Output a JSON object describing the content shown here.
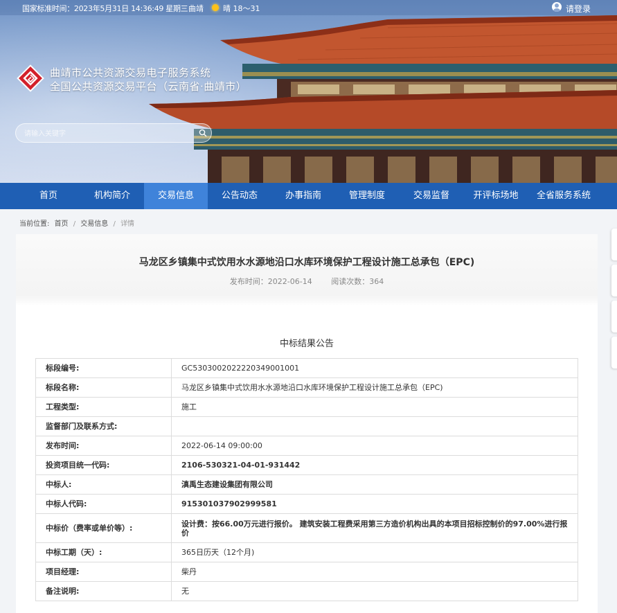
{
  "topbar": {
    "time_text": "国家标准时间：2023年5月31日 14:36:49 星期三",
    "city": "曲靖",
    "weather": "晴 18～31",
    "login": "请登录"
  },
  "site": {
    "title_line1": "曲靖市公共资源交易电子服务系统",
    "title_line2": "全国公共资源交易平台（云南省·曲靖市）"
  },
  "search": {
    "placeholder": "请输入关键字"
  },
  "nav": {
    "items": [
      "首页",
      "机构简介",
      "交易信息",
      "公告动态",
      "办事指南",
      "管理制度",
      "交易监督",
      "开评标场地",
      "全省服务系统"
    ],
    "active_index": 2
  },
  "breadcrumb": {
    "label": "当前位置:",
    "items": [
      "首页",
      "交易信息",
      "详情"
    ]
  },
  "article": {
    "title": "马龙区乡镇集中式饮用水水源地沿口水库环境保护工程设计施工总承包（EPC)",
    "publish": "发布时间：2022-06-14",
    "views": "阅读次数：364"
  },
  "notice": {
    "title": "中标结果公告",
    "rows": [
      {
        "key": "标段编号:",
        "value": "GC5303002022220349001001"
      },
      {
        "key": "标段名称:",
        "value": "马龙区乡镇集中式饮用水水源地沿口水库环境保护工程设计施工总承包（EPC)"
      },
      {
        "key": "工程类型:",
        "value": "施工"
      },
      {
        "key": "监督部门及联系方式:",
        "value": ""
      },
      {
        "key": "发布时间:",
        "value": "2022-06-14 09:00:00"
      },
      {
        "key": "投资项目统一代码:",
        "value": "2106-530321-04-01-931442"
      },
      {
        "key": "中标人:",
        "value": "滇禹生态建设集团有限公司"
      },
      {
        "key": "中标人代码:",
        "value": "915301037902999581"
      },
      {
        "key": "中标价（费率或单价等）:",
        "value": "设计费：按66.00万元进行报价。 建筑安装工程费采用第三方造价机构出具的本项目招标控制价的97.00%进行报价"
      },
      {
        "key": "中标工期（天）:",
        "value": "365日历天（12个月)"
      },
      {
        "key": "项目经理:",
        "value": "柴丹"
      },
      {
        "key": "备注说明:",
        "value": "无"
      }
    ]
  },
  "colors": {
    "nav_bg": "#1f5fb4",
    "nav_active": "#3f83da",
    "logo_red": "#d3202a"
  }
}
